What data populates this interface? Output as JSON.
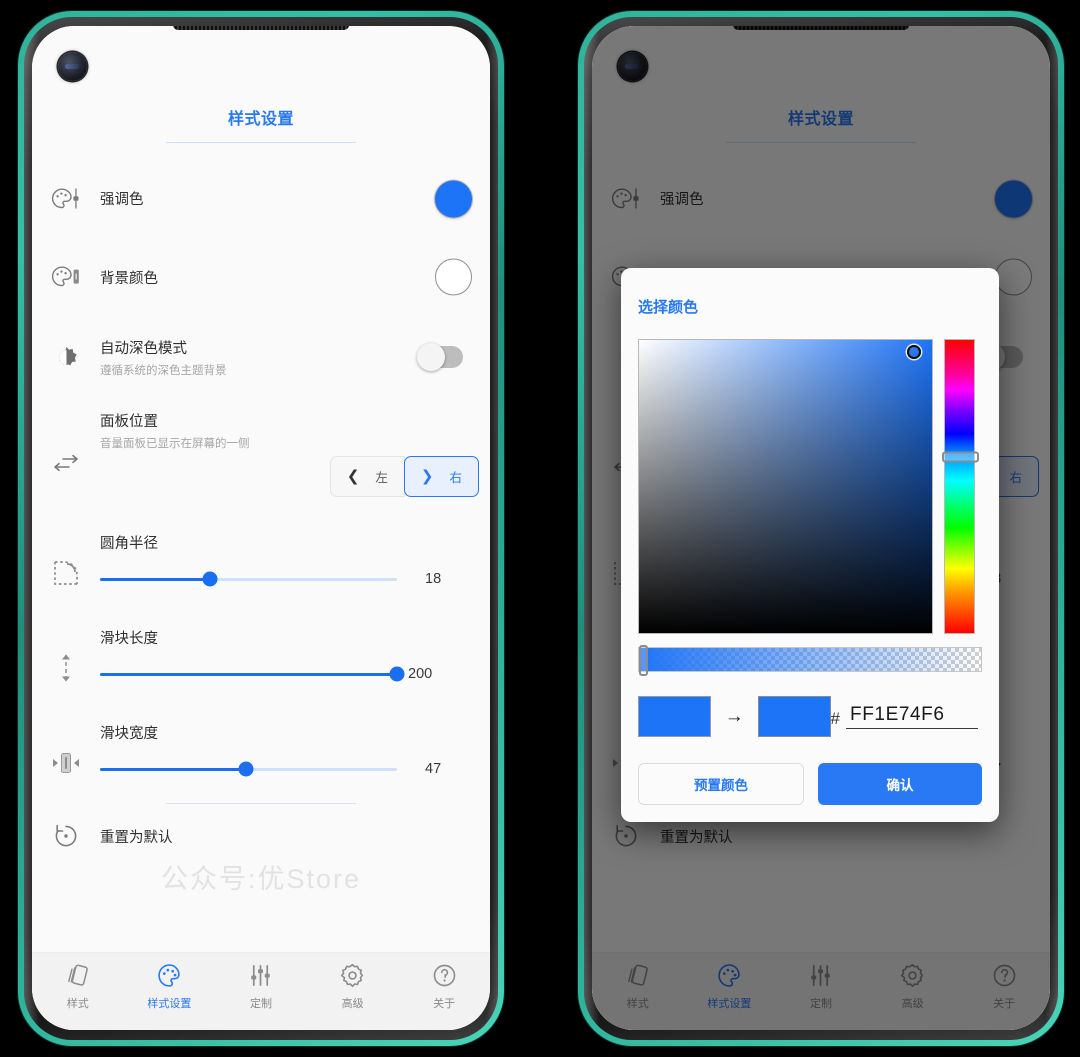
{
  "app": {
    "page_title": "样式设置",
    "watermark": "公众号:优Store"
  },
  "settings": {
    "accent": {
      "label": "强调色",
      "icon": "palette-slider-icon",
      "swatch_color": "#1e74f6"
    },
    "background": {
      "label": "背景颜色",
      "icon": "palette-bar-icon",
      "swatch_color": "#ffffff"
    },
    "dark_mode": {
      "label": "自动深色模式",
      "sub": "遵循系统的深色主题背景",
      "icon": "brightness-contrast-icon",
      "state": "off"
    },
    "panel_position": {
      "label": "面板位置",
      "sub": "音量面板已显示在屏幕的一侧",
      "icon": "left-right-arrows-icon",
      "options": [
        {
          "label": "左",
          "icon": "chevron-left-icon",
          "selected": false
        },
        {
          "label": "右",
          "icon": "chevron-right-icon",
          "selected": true
        }
      ]
    },
    "corner_radius": {
      "label": "圆角半径",
      "icon": "rounded-corner-icon",
      "value": "18",
      "percent": 37
    },
    "slider_length": {
      "label": "滑块长度",
      "icon": "height-arrows-icon",
      "value": "200",
      "percent": 100
    },
    "slider_width": {
      "label": "滑块宽度",
      "icon": "width-arrows-icon",
      "value": "47",
      "percent": 49
    },
    "reset": {
      "label": "重置为默认",
      "icon": "restore-icon"
    }
  },
  "bottom_nav": {
    "items": [
      {
        "label": "样式",
        "icon": "style-cards-icon",
        "active": false
      },
      {
        "label": "样式设置",
        "icon": "palette-icon",
        "active": true
      },
      {
        "label": "定制",
        "icon": "sliders-icon",
        "active": false
      },
      {
        "label": "高级",
        "icon": "gear-icon",
        "active": false
      },
      {
        "label": "关于",
        "icon": "question-mark-icon",
        "active": false
      }
    ]
  },
  "dialog": {
    "title": "选择颜色",
    "hex_prefix": "#",
    "hex_value": "FF1E74F6",
    "old_color": "#1e74f6",
    "new_color": "#1e74f6",
    "arrow": "→",
    "preset_button": "预置颜色",
    "confirm_button": "确认",
    "sv_cursor": {
      "x_percent": 94,
      "y_percent": 4
    },
    "hue_thumb_percent": 40,
    "alpha_thumb_percent": 0
  }
}
